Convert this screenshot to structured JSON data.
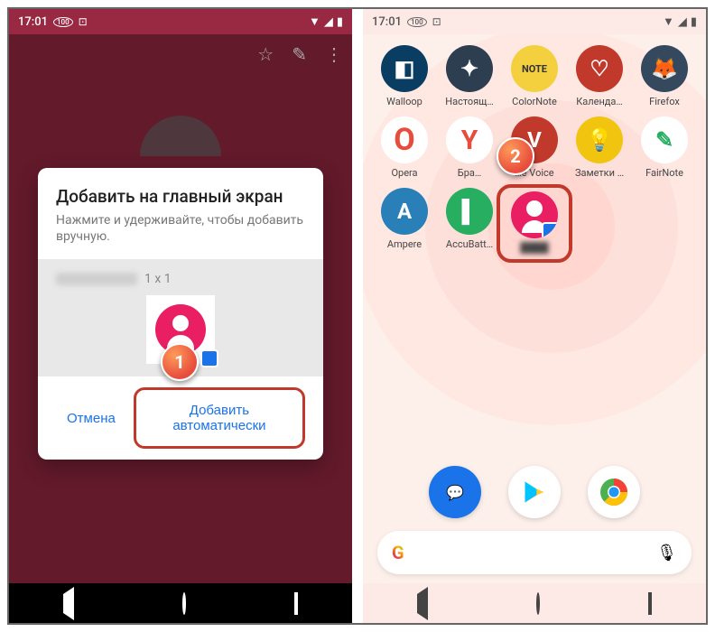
{
  "status": {
    "time": "17:01",
    "age_badge": "100",
    "signal": "▲",
    "wifi": "▼",
    "battery": "█"
  },
  "left": {
    "toolbar": {
      "star": "☆",
      "pencil": "✎",
      "more": "⋮"
    },
    "dialog": {
      "title": "Добавить на главный экран",
      "subtitle": "Нажмите и удерживайте, чтобы добавить вручную.",
      "size_label": "1 x 1",
      "cancel": "Отмена",
      "confirm": "Добавить автоматически"
    }
  },
  "right": {
    "apps": [
      {
        "label": "Walloop",
        "bg": "#0a3d62",
        "glyph": "◧"
      },
      {
        "label": "Настоящ…",
        "bg": "#2c3e50",
        "glyph": "✦"
      },
      {
        "label": "ColorNote",
        "bg": "#f4d03f",
        "glyph": "NOTE"
      },
      {
        "label": "Календа…",
        "bg": "#c0392b",
        "glyph": "♡"
      },
      {
        "label": "Firefox",
        "bg": "#34495e",
        "glyph": "🦊"
      },
      {
        "label": "Opera",
        "bg": "#ffffff",
        "glyph": "O"
      },
      {
        "label": "Бра…",
        "bg": "#ffffff",
        "glyph": "Y"
      },
      {
        "label": "…e Voice",
        "bg": "#c0392b",
        "glyph": "V"
      },
      {
        "label": "Заметки …",
        "bg": "#f1c40f",
        "glyph": "💡"
      },
      {
        "label": "FairNote",
        "bg": "#ffffff",
        "glyph": "✎"
      },
      {
        "label": "Ampere",
        "bg": "#2980b9",
        "glyph": "A"
      },
      {
        "label": "AccuBatt…",
        "bg": "#27ae60",
        "glyph": "▌"
      },
      {
        "label": "",
        "bg": "#e91e63",
        "glyph": "contact"
      }
    ],
    "dock": {
      "messages_bg": "#1a73e8",
      "play_bg": "#ffffff",
      "chrome_bg": "#ffffff"
    },
    "search": {
      "g": "G",
      "mic": "🎙"
    }
  },
  "steps": {
    "one": "1",
    "two": "2"
  }
}
